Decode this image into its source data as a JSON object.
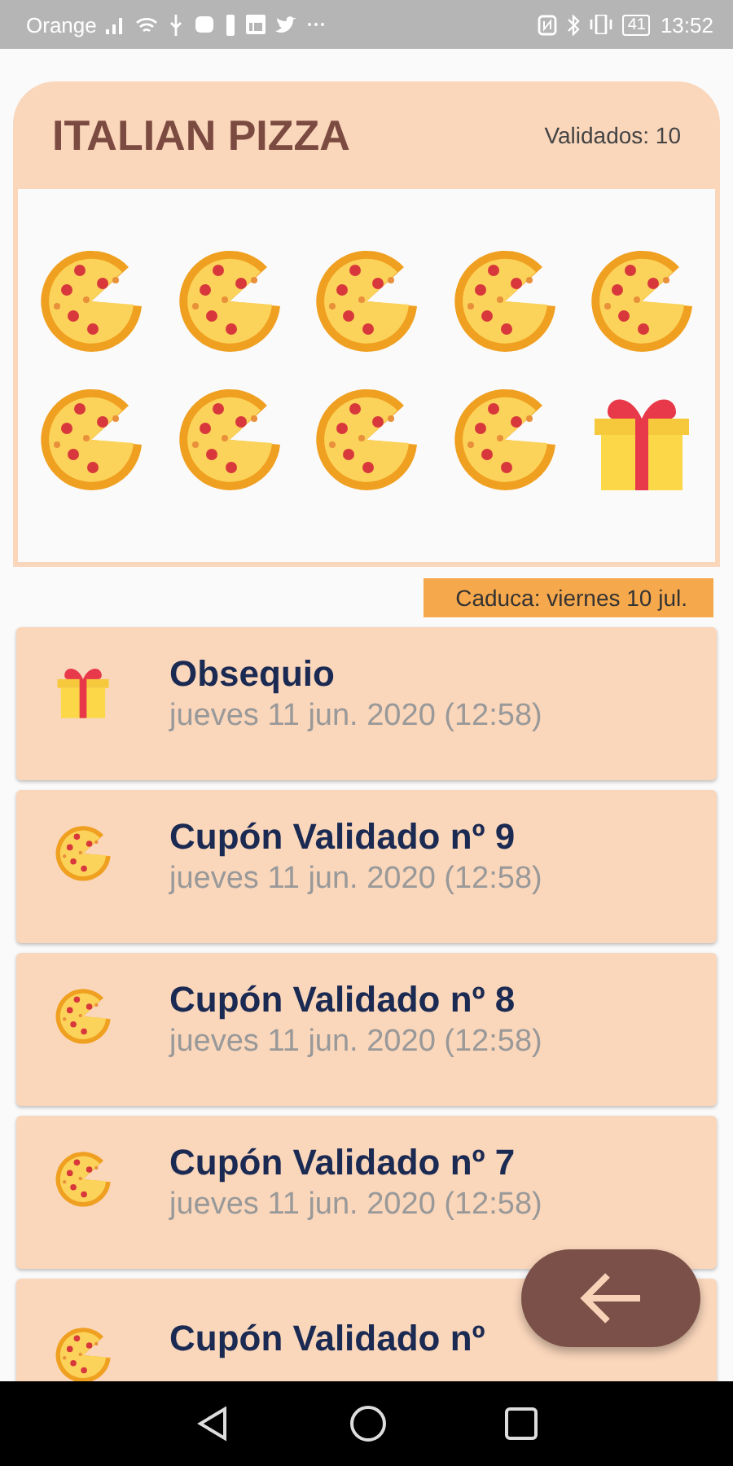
{
  "status_bar": {
    "carrier": "Orange",
    "battery": "41",
    "time": "13:52"
  },
  "card": {
    "title": "ITALIAN PIZZA",
    "validated": "Validados: 10",
    "stamps": [
      {
        "kind": "pizza"
      },
      {
        "kind": "pizza"
      },
      {
        "kind": "pizza"
      },
      {
        "kind": "pizza"
      },
      {
        "kind": "pizza"
      },
      {
        "kind": "pizza"
      },
      {
        "kind": "pizza"
      },
      {
        "kind": "pizza"
      },
      {
        "kind": "pizza"
      },
      {
        "kind": "gift"
      }
    ],
    "expires": "Caduca: viernes 10 jul."
  },
  "history": [
    {
      "kind": "gift",
      "title": "Obsequio",
      "date": "jueves 11 jun. 2020 (12:58)"
    },
    {
      "kind": "pizza",
      "title": "Cupón Validado nº 9",
      "date": "jueves 11 jun. 2020 (12:58)"
    },
    {
      "kind": "pizza",
      "title": "Cupón Validado nº 8",
      "date": "jueves 11 jun. 2020 (12:58)"
    },
    {
      "kind": "pizza",
      "title": "Cupón Validado nº 7",
      "date": "jueves 11 jun. 2020 (12:58)"
    },
    {
      "kind": "pizza",
      "title": "Cupón Validado nº"
    }
  ]
}
